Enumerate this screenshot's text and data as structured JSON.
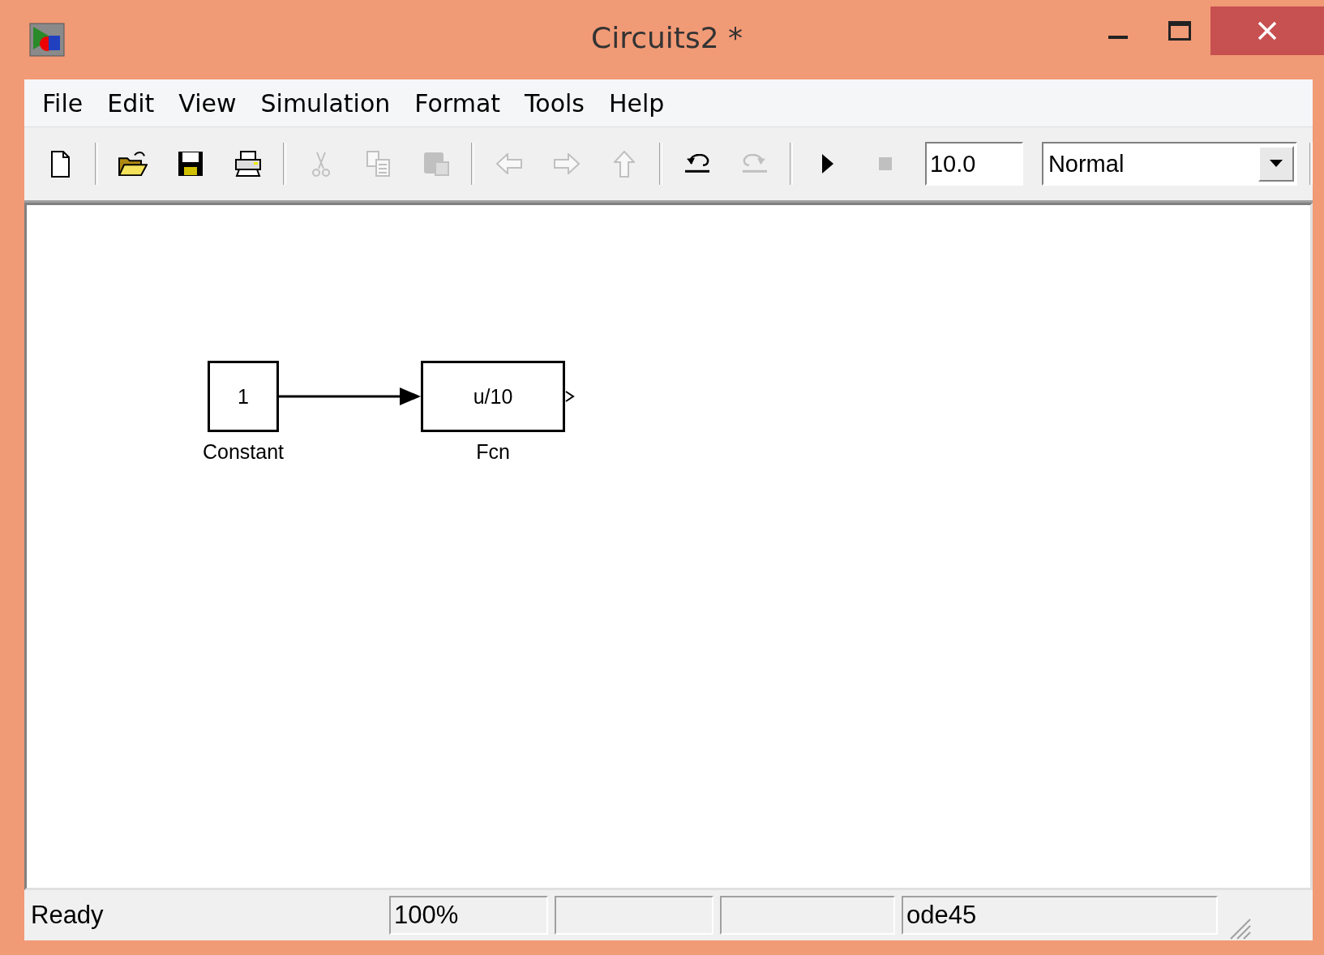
{
  "window": {
    "title": "Circuits2 *"
  },
  "menu": [
    "File",
    "Edit",
    "View",
    "Simulation",
    "Format",
    "Tools",
    "Help"
  ],
  "toolbar": [
    {
      "kind": "new",
      "disabled": false
    },
    {
      "kind": "sep"
    },
    {
      "kind": "open",
      "disabled": false
    },
    {
      "kind": "save",
      "disabled": false
    },
    {
      "kind": "print",
      "disabled": false
    },
    {
      "kind": "sep"
    },
    {
      "kind": "cut",
      "disabled": true
    },
    {
      "kind": "copy",
      "disabled": true
    },
    {
      "kind": "paste",
      "disabled": true
    },
    {
      "kind": "sep"
    },
    {
      "kind": "back",
      "disabled": true
    },
    {
      "kind": "forward",
      "disabled": true
    },
    {
      "kind": "up",
      "disabled": true
    },
    {
      "kind": "sep"
    },
    {
      "kind": "undo",
      "disabled": false
    },
    {
      "kind": "redo",
      "disabled": true
    },
    {
      "kind": "sep"
    },
    {
      "kind": "run",
      "disabled": false
    },
    {
      "kind": "stop",
      "disabled": true
    }
  ],
  "stop_time": {
    "value": "10.0"
  },
  "mode": {
    "value": "Normal"
  },
  "canvas": {
    "blocks": [
      {
        "text": "1",
        "label": "Constant",
        "output_connected": true
      },
      {
        "text": "u/10",
        "label": "Fcn",
        "output_connected": false
      }
    ]
  },
  "status_bar": {
    "panes": [
      {
        "kind": "text",
        "text": "Ready"
      },
      {
        "kind": "text",
        "text": "100%"
      },
      {
        "kind": "blank"
      },
      {
        "kind": "blank"
      },
      {
        "kind": "text",
        "text": "ode45"
      }
    ]
  }
}
